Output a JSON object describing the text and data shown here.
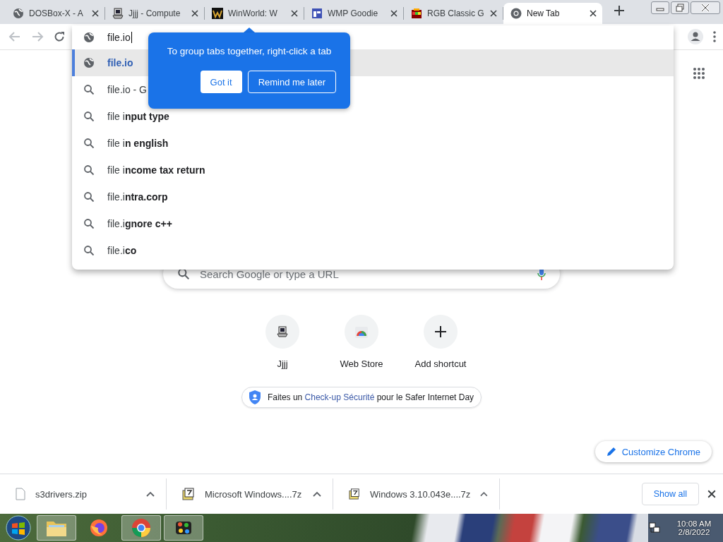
{
  "tabs": [
    {
      "title": "DOSBox-X - A",
      "kind": "globe",
      "selected": false
    },
    {
      "title": "Jjjj - Compute",
      "kind": "computer",
      "selected": false
    },
    {
      "title": "WinWorld: W",
      "kind": "mark",
      "selected": false
    },
    {
      "title": "WMP Goodie",
      "kind": "window",
      "selected": false
    },
    {
      "title": "RGB Classic G",
      "kind": "colors",
      "selected": false
    },
    {
      "title": "New Tab",
      "kind": "chrome",
      "selected": true
    }
  ],
  "omnibox": {
    "address": "file.io",
    "suggestions": [
      {
        "kind": "url",
        "text": "file.io",
        "selected": true
      },
      {
        "kind": "search",
        "text": "file.io - G",
        "selected": false
      },
      {
        "kind": "search",
        "text": "file i**nput type**",
        "selected": false
      },
      {
        "kind": "search",
        "text": "file i**n english**",
        "selected": false
      },
      {
        "kind": "search",
        "text": "file i**ncome tax return**",
        "selected": false
      },
      {
        "kind": "search",
        "text": "file.i**ntra.corp**",
        "selected": false
      },
      {
        "kind": "search",
        "text": "file.i**gnore c++**",
        "selected": false
      },
      {
        "kind": "search",
        "text": "file.i**co**",
        "selected": false
      }
    ]
  },
  "tip": {
    "message": "To group tabs together, right-click a tab",
    "buttons": [
      "Got it",
      "Remind me later"
    ]
  },
  "new_tab_page": {
    "search_placeholder": "Search Google or type a URL",
    "shortcuts": [
      {
        "label": "Jjjj",
        "kind": "site"
      },
      {
        "label": "Web Store",
        "kind": "store"
      },
      {
        "label": "Add shortcut",
        "kind": "add"
      }
    ],
    "promo": {
      "before": "Faites un",
      "link": "Check-up Sécurité",
      "after": "pour le Safer Internet Day"
    },
    "customize_button": "Customize Chrome"
  },
  "downloads": {
    "items": [
      {
        "name": "s3drivers.zip",
        "kind": "file"
      },
      {
        "name": "Microsoft Windows....7z",
        "kind": "archive"
      },
      {
        "name": "Windows 3.10.043e....7z",
        "kind": "archive"
      }
    ],
    "show_all": "Show all"
  },
  "taskbar": {
    "apps": [
      {
        "kind": "explorer",
        "running": true
      },
      {
        "kind": "firefox",
        "running": false
      },
      {
        "kind": "chrome",
        "running": true
      },
      {
        "kind": "dosbox",
        "running": true
      }
    ],
    "time": "10:08 AM",
    "date": "2/8/2022"
  }
}
